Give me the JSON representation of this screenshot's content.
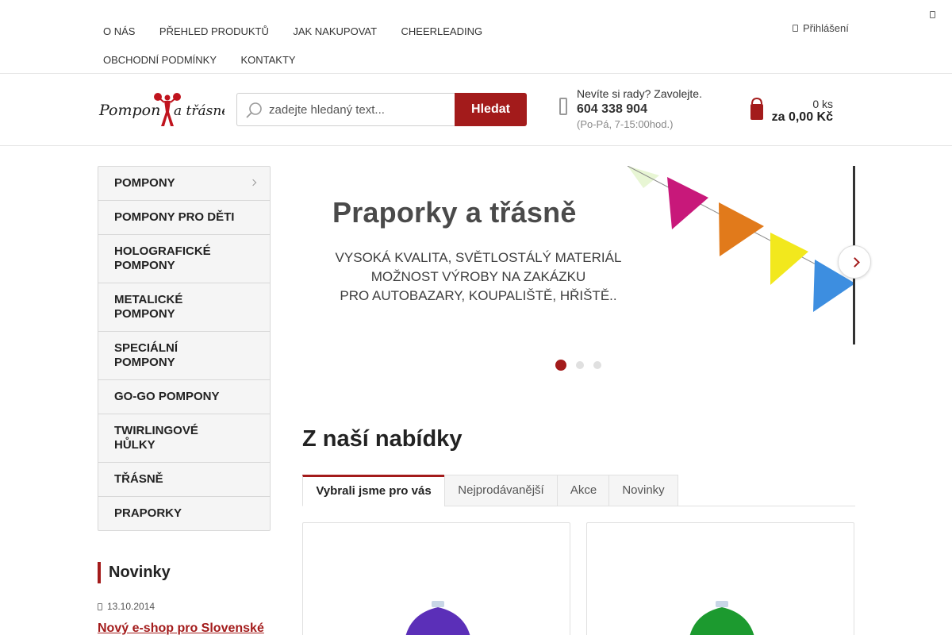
{
  "topnav": {
    "items": [
      "O nás",
      "Přehled produktů",
      "Jak nakupovat",
      "Cheerleading",
      "Obchodní podmínky",
      "Kontakty"
    ],
    "login_label": "Přihlášení"
  },
  "logo": {
    "alt": "Pompony a třásně"
  },
  "search": {
    "placeholder": "zadejte hledaný text...",
    "button_label": "Hledat",
    "icon": "search-icon"
  },
  "contact": {
    "question": "Nevíte si rady? Zavolejte.",
    "phone": "604 338 904",
    "hours": "(Po-Pá, 7-15:00hod.)"
  },
  "cart": {
    "count": "0 ks",
    "total": "za 0,00 Kč"
  },
  "categories": [
    {
      "label": "Pompony"
    },
    {
      "label": "Pompony pro děti"
    },
    {
      "label": "Holografické pompony"
    },
    {
      "label": "Metalické pompony"
    },
    {
      "label": "Speciální pompony"
    },
    {
      "label": "Go-go pompony"
    },
    {
      "label": "Twirlingové hůlky"
    },
    {
      "label": "Třásně"
    },
    {
      "label": "Praporky"
    }
  ],
  "news": {
    "title": "Novinky",
    "date": "13.10.2014",
    "link": "Nový e-shop pro Slovenské"
  },
  "banner": {
    "title": "Praporky a třásně",
    "lines": [
      "Vysoká kvalita, světlostálý materiál",
      "Možnost výroby na zakázku",
      "pro autobazary, koupaliště, hřiště.."
    ],
    "flag_colors": [
      "#c8187a",
      "#e17a1b",
      "#f2e81d",
      "#3d8ee0"
    ],
    "slide_count": 3,
    "active_slide": 1
  },
  "offers": {
    "title": "Z naší nabídky",
    "tabs": [
      "Vybrali jsme pro vás",
      "Nejprodávanější",
      "Akce",
      "Novinky"
    ],
    "active_tab": 0,
    "products": [
      {
        "color": "#5b2fb8"
      },
      {
        "color": "#1c9a2f"
      }
    ]
  },
  "colors": {
    "accent": "#a31b1b"
  }
}
